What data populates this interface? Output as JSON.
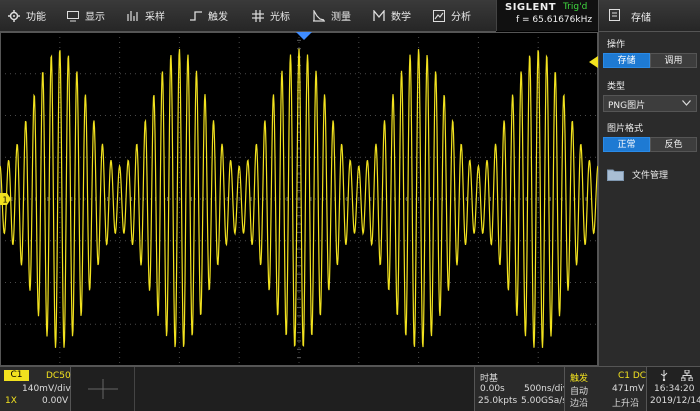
{
  "menu": {
    "items": [
      {
        "name": "menu-utility",
        "label": "功能",
        "icon": "gear-icon"
      },
      {
        "name": "menu-display",
        "label": "显示",
        "icon": "monitor-icon"
      },
      {
        "name": "menu-acquire",
        "label": "采样",
        "icon": "acquire-icon"
      },
      {
        "name": "menu-trigger",
        "label": "触发",
        "icon": "trigger-icon"
      },
      {
        "name": "menu-cursors",
        "label": "光标",
        "icon": "cursor-icon"
      },
      {
        "name": "menu-measure",
        "label": "测量",
        "icon": "measure-icon"
      },
      {
        "name": "menu-math",
        "label": "数学",
        "icon": "math-icon"
      },
      {
        "name": "menu-analysis",
        "label": "分析",
        "icon": "analysis-icon"
      }
    ]
  },
  "header": {
    "brand": "SIGLENT",
    "trig_status": "Trig'd",
    "frequency": "f = 65.61676kHz"
  },
  "panel": {
    "title": "存储",
    "icon": "save-icon",
    "operation_label": "操作",
    "op_save": "存储",
    "op_recall": "调用",
    "type_label": "类型",
    "type_value": "PNG图片",
    "format_label": "图片格式",
    "fmt_normal": "正常",
    "fmt_invert": "反色",
    "file_manager": "文件管理"
  },
  "channel": {
    "name": "C1",
    "coupling": "DC50",
    "scale": "140mV/div",
    "probe": "1X",
    "offset": "0.00V"
  },
  "timebase": {
    "label": "时基",
    "delay": "0.00s",
    "scale": "500ns/div",
    "points": "25.0kpts",
    "rate": "5.00GSa/s"
  },
  "trigger": {
    "label": "触发",
    "source": "C1 DC",
    "mode": "自动",
    "level": "471mV",
    "type": "边沿",
    "slope": "上升沿"
  },
  "clock": {
    "time": "16:34:20",
    "date": "2019/12/14"
  },
  "colors": {
    "trace": "#f2e21f",
    "accent": "#1e7ad3",
    "trig_status": "#3fd83f",
    "trigger_marker": "#3f8cff"
  },
  "waveform": {
    "carrier_cycles_on_screen": 70,
    "envelope_peaks_on_screen": 5
  }
}
